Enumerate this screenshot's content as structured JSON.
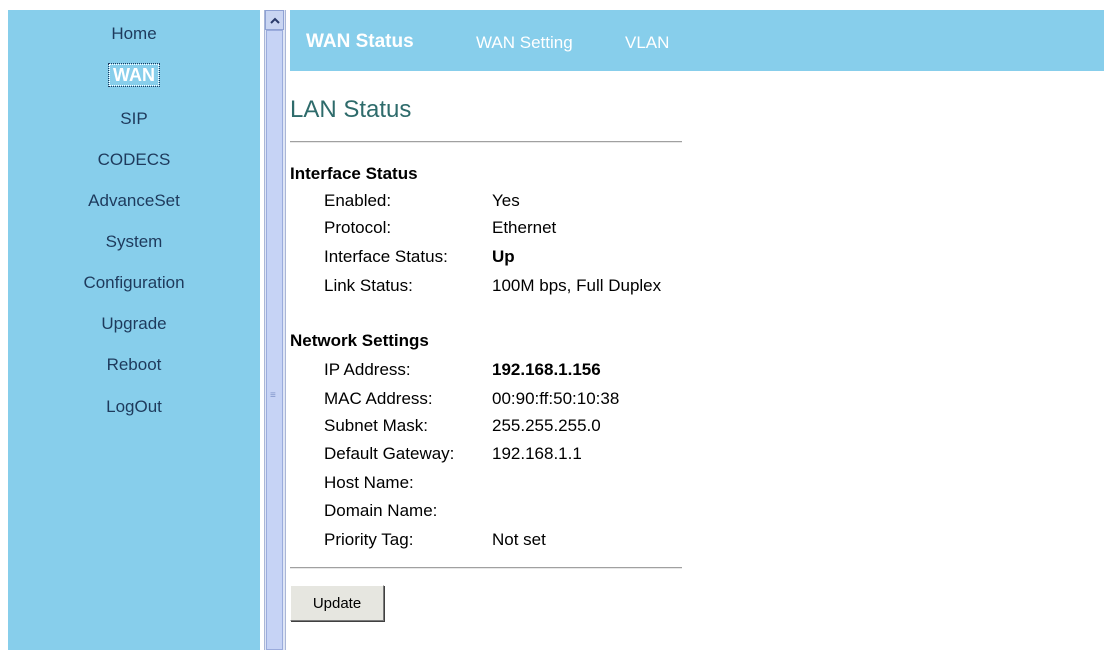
{
  "sidebar": {
    "items": [
      {
        "label": "Home"
      },
      {
        "label": "WAN",
        "active": true
      },
      {
        "label": "SIP"
      },
      {
        "label": "CODECS"
      },
      {
        "label": "AdvanceSet"
      },
      {
        "label": "System"
      },
      {
        "label": "Configuration"
      },
      {
        "label": "Upgrade"
      },
      {
        "label": "Reboot"
      },
      {
        "label": "LogOut"
      }
    ]
  },
  "tabs": [
    {
      "label": "WAN Status",
      "active": true
    },
    {
      "label": "WAN Setting"
    },
    {
      "label": "VLAN"
    }
  ],
  "page_title": "LAN Status",
  "interface_status": {
    "title": "Interface Status",
    "rows": [
      {
        "label": "Enabled:",
        "value": "Yes"
      },
      {
        "label": "Protocol:",
        "value": "Ethernet"
      },
      {
        "label": "Interface Status:",
        "value": "Up"
      },
      {
        "label": "Link Status:",
        "value": "100M bps, Full Duplex"
      }
    ]
  },
  "network_settings": {
    "title": "Network Settings",
    "rows": [
      {
        "label": "IP Address:",
        "value": "192.168.1.156"
      },
      {
        "label": "MAC Address:",
        "value": "00:90:ff:50:10:38"
      },
      {
        "label": "Subnet Mask:",
        "value": "255.255.255.0"
      },
      {
        "label": "Default Gateway:",
        "value": "192.168.1.1"
      },
      {
        "label": "Host Name:",
        "value": ""
      },
      {
        "label": "Domain Name:",
        "value": ""
      },
      {
        "label": "Priority Tag:",
        "value": "Not set"
      }
    ]
  },
  "update_button": "Update",
  "colors": {
    "nav_background": "#87ceeb",
    "nav_text": "#1e3a5c",
    "title_color": "#2e6b6b"
  },
  "icons": {
    "scroll_up": "chevron-up-icon",
    "scroll_grip": "grip-icon"
  }
}
